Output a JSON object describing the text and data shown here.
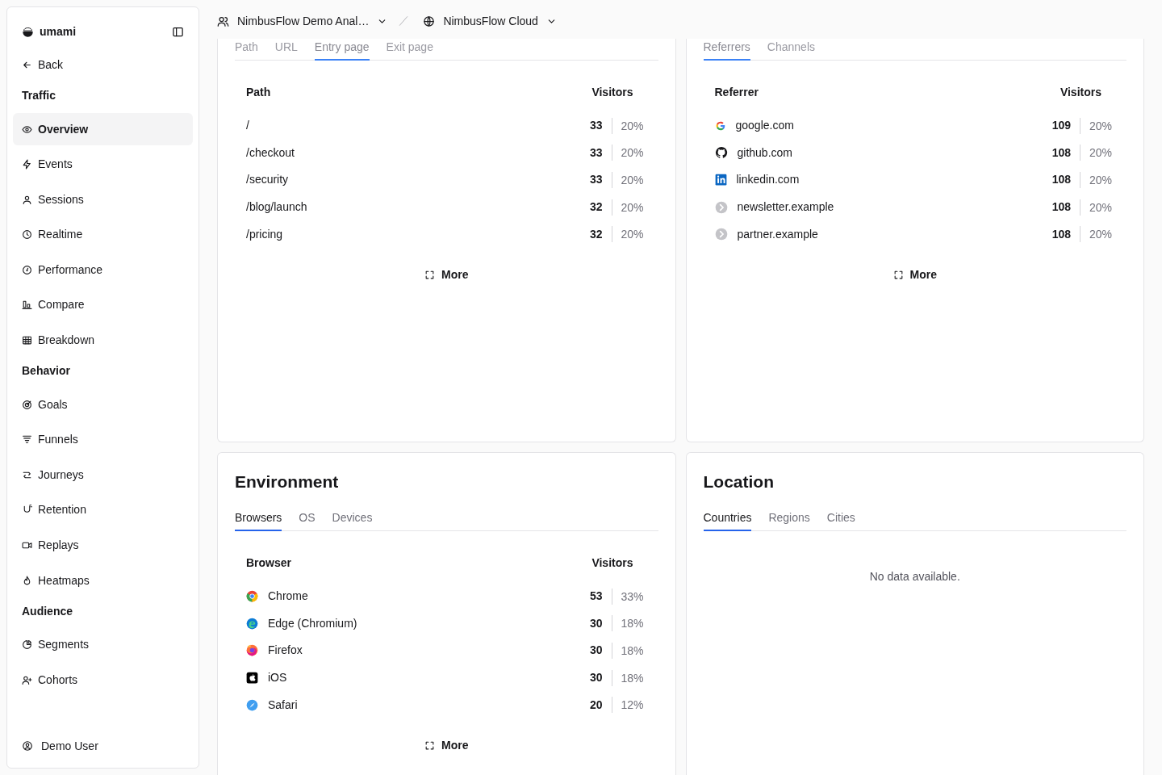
{
  "sidebar": {
    "brand": "umami",
    "back": "Back",
    "sections": [
      {
        "title": "Traffic",
        "items": [
          {
            "label": "Overview",
            "selected": true
          },
          {
            "label": "Events",
            "selected": false
          },
          {
            "label": "Sessions",
            "selected": false
          },
          {
            "label": "Realtime",
            "selected": false
          },
          {
            "label": "Performance",
            "selected": false
          },
          {
            "label": "Compare",
            "selected": false
          },
          {
            "label": "Breakdown",
            "selected": false
          }
        ]
      },
      {
        "title": "Behavior",
        "items": [
          {
            "label": "Goals",
            "selected": false
          },
          {
            "label": "Funnels",
            "selected": false
          },
          {
            "label": "Journeys",
            "selected": false
          },
          {
            "label": "Retention",
            "selected": false
          },
          {
            "label": "Replays",
            "selected": false
          },
          {
            "label": "Heatmaps",
            "selected": false
          }
        ]
      },
      {
        "title": "Audience",
        "items": [
          {
            "label": "Segments",
            "selected": false
          },
          {
            "label": "Cohorts",
            "selected": false
          }
        ]
      }
    ],
    "user": "Demo User"
  },
  "header": {
    "team": "NimbusFlow Demo Anal…",
    "website": "NimbusFlow Cloud"
  },
  "panels": [
    {
      "tabs": [
        {
          "label": "Path",
          "selected": false
        },
        {
          "label": "URL",
          "selected": false
        },
        {
          "label": "Entry page",
          "selected": true
        },
        {
          "label": "Exit page",
          "selected": false
        }
      ],
      "columns": [
        "Path",
        "Visitors"
      ],
      "rows": [
        {
          "label": "/",
          "visitors": "33",
          "percent": "20%"
        },
        {
          "label": "/checkout",
          "visitors": "33",
          "percent": "20%"
        },
        {
          "label": "/security",
          "visitors": "33",
          "percent": "20%"
        },
        {
          "label": "/blog/launch",
          "visitors": "32",
          "percent": "20%"
        },
        {
          "label": "/pricing",
          "visitors": "32",
          "percent": "20%"
        }
      ],
      "more": "More"
    },
    {
      "tabs": [
        {
          "label": "Referrers",
          "selected": true
        },
        {
          "label": "Channels",
          "selected": false
        }
      ],
      "columns": [
        "Referrer",
        "Visitors"
      ],
      "rows": [
        {
          "label": "google.com",
          "visitors": "109",
          "percent": "20%"
        },
        {
          "label": "github.com",
          "visitors": "108",
          "percent": "20%"
        },
        {
          "label": "linkedin.com",
          "visitors": "108",
          "percent": "20%"
        },
        {
          "label": "newsletter.example",
          "visitors": "108",
          "percent": "20%"
        },
        {
          "label": "partner.example",
          "visitors": "108",
          "percent": "20%"
        }
      ],
      "more": "More"
    },
    {
      "title": "Environment",
      "tabs": [
        {
          "label": "Browsers",
          "selected": true
        },
        {
          "label": "OS",
          "selected": false
        },
        {
          "label": "Devices",
          "selected": false
        }
      ],
      "columns": [
        "Browser",
        "Visitors"
      ],
      "rows": [
        {
          "label": "Chrome",
          "visitors": "53",
          "percent": "33%"
        },
        {
          "label": "Edge (Chromium)",
          "visitors": "30",
          "percent": "18%"
        },
        {
          "label": "Firefox",
          "visitors": "30",
          "percent": "18%"
        },
        {
          "label": "iOS",
          "visitors": "30",
          "percent": "18%"
        },
        {
          "label": "Safari",
          "visitors": "20",
          "percent": "12%"
        }
      ],
      "more": "More"
    },
    {
      "title": "Location",
      "tabs": [
        {
          "label": "Countries",
          "selected": true
        },
        {
          "label": "Regions",
          "selected": false
        },
        {
          "label": "Cities",
          "selected": false
        }
      ],
      "empty": "No data available."
    }
  ]
}
